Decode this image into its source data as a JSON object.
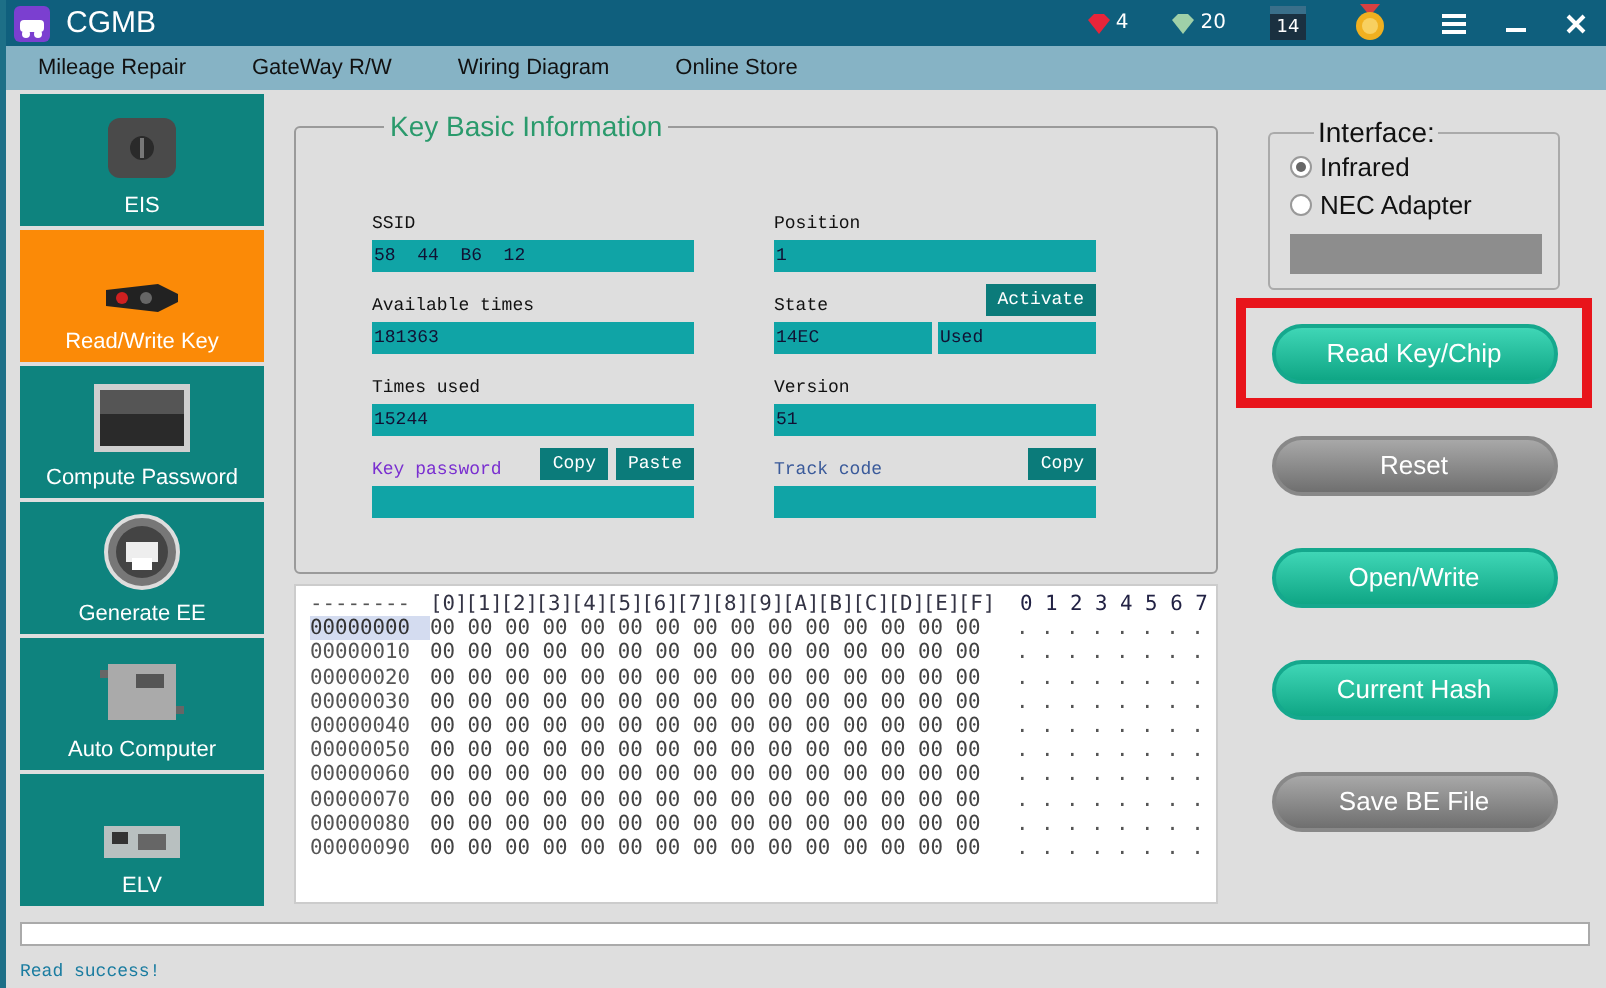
{
  "window": {
    "title": "CGMB"
  },
  "title_bar": {
    "rubies": "4",
    "diamonds": "20",
    "calendar_day": "14"
  },
  "menu": [
    "Mileage Repair",
    "GateWay R/W",
    "Wiring Diagram",
    "Online Store"
  ],
  "sidebar": [
    {
      "label": "EIS",
      "selected": false,
      "kind": "ignition"
    },
    {
      "label": "Read/Write Key",
      "selected": true,
      "kind": "fob"
    },
    {
      "label": "Compute Password",
      "selected": false,
      "kind": "keypad"
    },
    {
      "label": "Generate EE",
      "selected": false,
      "kind": "printer"
    },
    {
      "label": "Auto Computer",
      "selected": false,
      "kind": "ecu"
    },
    {
      "label": "ELV",
      "selected": false,
      "kind": "board"
    }
  ],
  "key_info": {
    "title": "Key Basic Information",
    "fields": [
      {
        "label": "SSID",
        "kind": "plain",
        "values": [
          "58  44  B6  12"
        ]
      },
      {
        "label": "Position",
        "kind": "plain",
        "values": [
          "1"
        ]
      },
      {
        "label": "Available times",
        "kind": "plain",
        "values": [
          "181363"
        ]
      },
      {
        "label": "State",
        "kind": "plain",
        "values": [
          "14EC",
          "Used"
        ],
        "buttons": [
          "Activate"
        ]
      },
      {
        "label": "Times used",
        "kind": "plain",
        "values": [
          "15244"
        ]
      },
      {
        "label": "Version",
        "kind": "plain",
        "values": [
          "51"
        ]
      },
      {
        "label": "Key password",
        "kind": "secret",
        "buttons": [
          "Copy",
          "Paste"
        ]
      },
      {
        "label": "Track code",
        "kind": "code",
        "buttons": [
          "Copy"
        ]
      }
    ]
  },
  "hex": {
    "address_header": "--------",
    "columns": [
      "[0]",
      "[1]",
      "[2]",
      "[3]",
      "[4]",
      "[5]",
      "[6]",
      "[7]",
      "[8]",
      "[9]",
      "[A]",
      "[B]",
      "[C]",
      "[D]",
      "[E]",
      "[F]"
    ],
    "ascii_header": "0 1 2 3 4 5 6 7",
    "rows": [
      {
        "address": "00000000",
        "bytes": "00 00 00 00 00 00 00 00 00 00 00 00 00 00 00",
        "ascii": ". . . . . . . .",
        "selected": true
      },
      {
        "address": "00000010",
        "bytes": "00 00 00 00 00 00 00 00 00 00 00 00 00 00 00",
        "ascii": ". . . . . . . .",
        "selected": false
      },
      {
        "address": "00000020",
        "bytes": "00 00 00 00 00 00 00 00 00 00 00 00 00 00 00",
        "ascii": ". . . . . . . .",
        "selected": false
      },
      {
        "address": "00000030",
        "bytes": "00 00 00 00 00 00 00 00 00 00 00 00 00 00 00",
        "ascii": ". . . . . . . .",
        "selected": false
      },
      {
        "address": "00000040",
        "bytes": "00 00 00 00 00 00 00 00 00 00 00 00 00 00 00",
        "ascii": ". . . . . . . .",
        "selected": false
      },
      {
        "address": "00000050",
        "bytes": "00 00 00 00 00 00 00 00 00 00 00 00 00 00 00",
        "ascii": ". . . . . . . .",
        "selected": false
      },
      {
        "address": "00000060",
        "bytes": "00 00 00 00 00 00 00 00 00 00 00 00 00 00 00",
        "ascii": ". . . . . . . .",
        "selected": false
      },
      {
        "address": "00000070",
        "bytes": "00 00 00 00 00 00 00 00 00 00 00 00 00 00 00",
        "ascii": ". . . . . . . .",
        "selected": false
      },
      {
        "address": "00000080",
        "bytes": "00 00 00 00 00 00 00 00 00 00 00 00 00 00 00",
        "ascii": ". . . . . . . .",
        "selected": false
      },
      {
        "address": "00000090",
        "bytes": "00 00 00 00 00 00 00 00 00 00 00 00 00 00 00",
        "ascii": ". . . . . . . .",
        "selected": false
      }
    ]
  },
  "interface": {
    "title": "Interface:",
    "options": [
      {
        "label": "Infrared",
        "selected": true
      },
      {
        "label": "NEC Adapter",
        "selected": false
      }
    ]
  },
  "actions": [
    {
      "label": "Read Key/Chip",
      "disabled": false,
      "highlighted": true
    },
    {
      "label": "Reset",
      "disabled": true,
      "highlighted": false
    },
    {
      "label": "Open/Write",
      "disabled": false,
      "highlighted": false
    },
    {
      "label": "Current Hash",
      "disabled": false,
      "highlighted": false
    },
    {
      "label": "Save BE File",
      "disabled": true,
      "highlighted": false
    }
  ],
  "progress": {
    "level": 0
  },
  "status_bar": "Read success!"
}
